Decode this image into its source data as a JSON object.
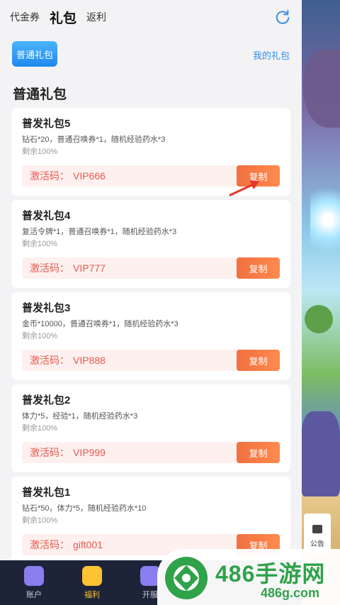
{
  "top_tabs": [
    {
      "label": "代金券"
    },
    {
      "label": "礼包"
    },
    {
      "label": "返利"
    }
  ],
  "sub_tab": {
    "label": "普通礼包"
  },
  "my_gift_link": "我的礼包",
  "section_title": "普通礼包",
  "code_label": "激活码：",
  "copy_label": "复制",
  "gifts": [
    {
      "title": "普发礼包5",
      "desc": "钻石*20，普通召唤券*1，随机经验药水*3",
      "remain": "剩余100%",
      "code": "VIP666"
    },
    {
      "title": "普发礼包4",
      "desc": "复活令牌*1，普通召唤券*1，随机经验药水*3",
      "remain": "剩余100%",
      "code": "VIP777"
    },
    {
      "title": "普发礼包3",
      "desc": "金币*10000，普通召唤券*1，随机经验药水*3",
      "remain": "剩余100%",
      "code": "VIP888"
    },
    {
      "title": "普发礼包2",
      "desc": "体力*5，经验*1，随机经验药水*3",
      "remain": "剩余100%",
      "code": "VIP999"
    },
    {
      "title": "普发礼包1",
      "desc": "钻石*50，体力*5，随机经验药水*10",
      "remain": "剩余100%",
      "code": "gift001"
    }
  ],
  "bottom_nav": [
    {
      "label": "账户",
      "icon": "account-icon"
    },
    {
      "label": "福利",
      "icon": "gift-box-icon"
    },
    {
      "label": "开服",
      "icon": "gamepad-icon"
    }
  ],
  "notice_label": "公告",
  "watermark": {
    "brand": "486手游网",
    "url": "486g.com"
  },
  "colors": {
    "accent_blue": "#2f8df0",
    "copy_orange": "#ff8a4e",
    "code_red": "#e95a4f",
    "nav_active": "#ffc233"
  }
}
